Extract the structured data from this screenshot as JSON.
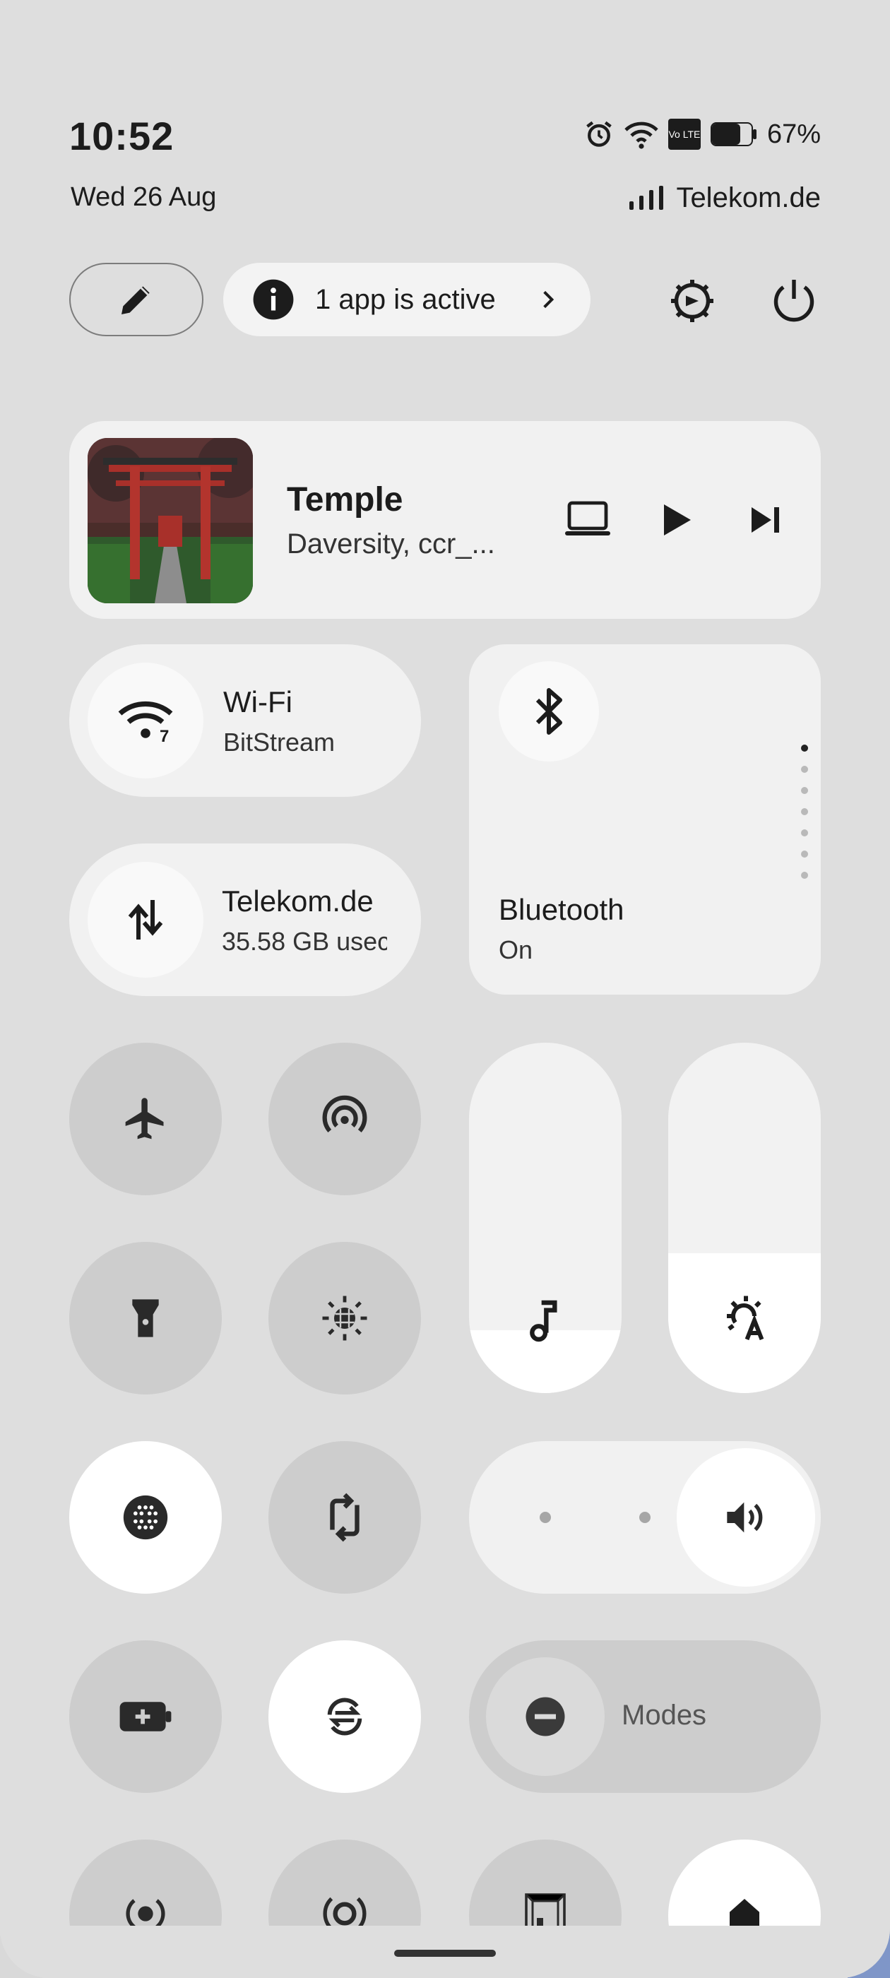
{
  "status": {
    "time": "10:52",
    "date": "Wed 26 Aug",
    "battery": "67%",
    "carrier": "Telekom.de",
    "volte_label": "Vo LTE",
    "icons": [
      "alarm-icon",
      "wifi-icon",
      "volte-icon",
      "battery-icon",
      "signal-icon"
    ]
  },
  "top_row": {
    "active_apps": "1 app is active",
    "icons": [
      "pencil-icon",
      "info-icon",
      "chevron-right-icon",
      "settings-icon",
      "power-icon"
    ]
  },
  "media": {
    "title": "Temple",
    "subtitle": "Daversity, ccr_...",
    "icons": [
      "cast-icon",
      "play-icon",
      "skip-next-icon"
    ]
  },
  "wifi": {
    "title": "Wi-Fi",
    "subtitle": "BitStream",
    "badge": "7"
  },
  "mobile_data": {
    "title": "Telekom.de",
    "subtitle": "35.58 GB usec"
  },
  "bluetooth": {
    "title": "Bluetooth",
    "subtitle": "On",
    "page": 1,
    "pages": 7
  },
  "sliders": {
    "media_volume_level": 0.18,
    "brightness_level": 0.4
  },
  "ring_mode": {
    "level": 3,
    "levels": 3
  },
  "modes": {
    "label": "Modes"
  },
  "accent": "#ffffff",
  "tile_off": "#cdcdcd",
  "tile_on": "#ffffff"
}
